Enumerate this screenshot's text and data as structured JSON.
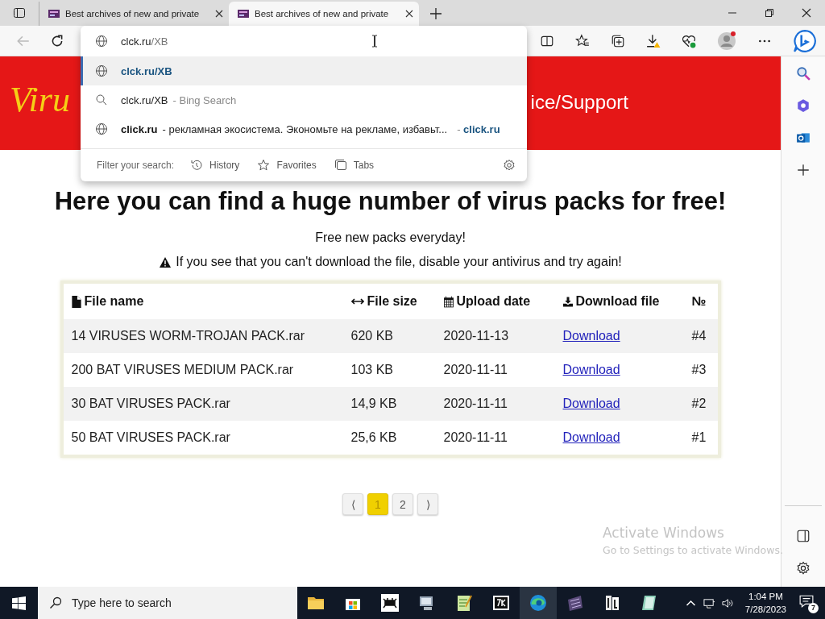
{
  "browser": {
    "tabs": [
      {
        "title": "Best archives of new and private",
        "selected": false
      },
      {
        "title": "Best archives of new and private",
        "selected": true
      }
    ],
    "address": {
      "value": "clck.ru",
      "completion": "/XB"
    },
    "suggestions": [
      {
        "kind": "url",
        "text": "clck.ru/XB",
        "selected": true
      },
      {
        "kind": "search",
        "text": "clck.ru/XB",
        "suffix": "- Bing Search",
        "selected": false
      },
      {
        "kind": "site",
        "title": "click.ru",
        "text": "- рекламная экосистема. Экономьте на рекламе, избавьт...",
        "suffix": "- **click.ru**",
        "selected": false
      }
    ],
    "filter": {
      "label": "Filter your search:",
      "options": [
        "History",
        "Favorites",
        "Tabs"
      ]
    }
  },
  "page": {
    "banner_left": "Viru",
    "banner_right": "ice/Support",
    "heading": "Here you can find a huge number of virus packs for free!",
    "subheading": "Free new packs everyday!",
    "warning": "If you see that you can't download the file, disable your antivirus and try again!",
    "table": {
      "columns": [
        "File name",
        "File size",
        "Upload date",
        "Download file",
        "№"
      ],
      "rows": [
        [
          "14 VIRUSES WORM-TROJAN PACK.rar",
          "620 KB",
          "2020-11-13",
          "Download",
          "#4"
        ],
        [
          "200 BAT VIRUSES MEDIUM PACK.rar",
          "103 KB",
          "2020-11-11",
          "Download",
          "#3"
        ],
        [
          "30 BAT VIRUSES PACK.rar",
          "14,9 KB",
          "2020-11-11",
          "Download",
          "#2"
        ],
        [
          "50 BAT VIRUSES PACK.rar",
          "25,6 KB",
          "2020-11-11",
          "Download",
          "#1"
        ]
      ]
    },
    "pagination": {
      "prev": "⟨",
      "pages": [
        {
          "label": "1",
          "selected": true
        },
        {
          "label": "2",
          "selected": false
        }
      ],
      "next": "⟩"
    }
  },
  "activation_notice": {
    "title": "Activate Windows",
    "text": "Go to Settings to activate Windows."
  },
  "taskbar": {
    "search_placeholder": "Type here to search",
    "time": "1:04 PM",
    "date": "7/28/2023",
    "notification_count": "7"
  }
}
